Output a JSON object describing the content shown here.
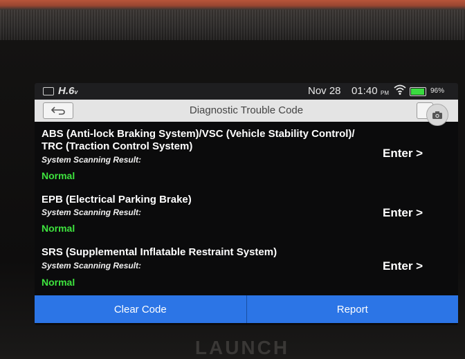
{
  "status_bar": {
    "voltage": "H.6",
    "voltage_unit": "v",
    "date": "Nov 28",
    "time": "01:40",
    "ampm": "PM",
    "battery_percent": "96%",
    "battery_level": 0.96
  },
  "header": {
    "title": "Diagnostic Trouble Code"
  },
  "systems": [
    {
      "name": "ABS (Anti-lock Braking System)/VSC (Vehicle Stability Control)/ TRC (Traction Control System)",
      "result_label": "System Scanning Result:",
      "result_value": "Normal",
      "action_label": "Enter >"
    },
    {
      "name": "EPB (Electrical Parking Brake)",
      "result_label": "System Scanning Result:",
      "result_value": "Normal",
      "action_label": "Enter >"
    },
    {
      "name": "SRS (Supplemental Inflatable Restraint System)",
      "result_label": "System Scanning Result:",
      "result_value": "Normal",
      "action_label": "Enter >"
    }
  ],
  "footer": {
    "clear_label": "Clear Code",
    "report_label": "Report"
  },
  "device": {
    "brand": "LAUNCH"
  },
  "colors": {
    "button_blue": "#2c75e6",
    "status_green": "#3ee43e",
    "title_bar": "#e4e4e4",
    "screen_bg": "#0b0b0c"
  }
}
